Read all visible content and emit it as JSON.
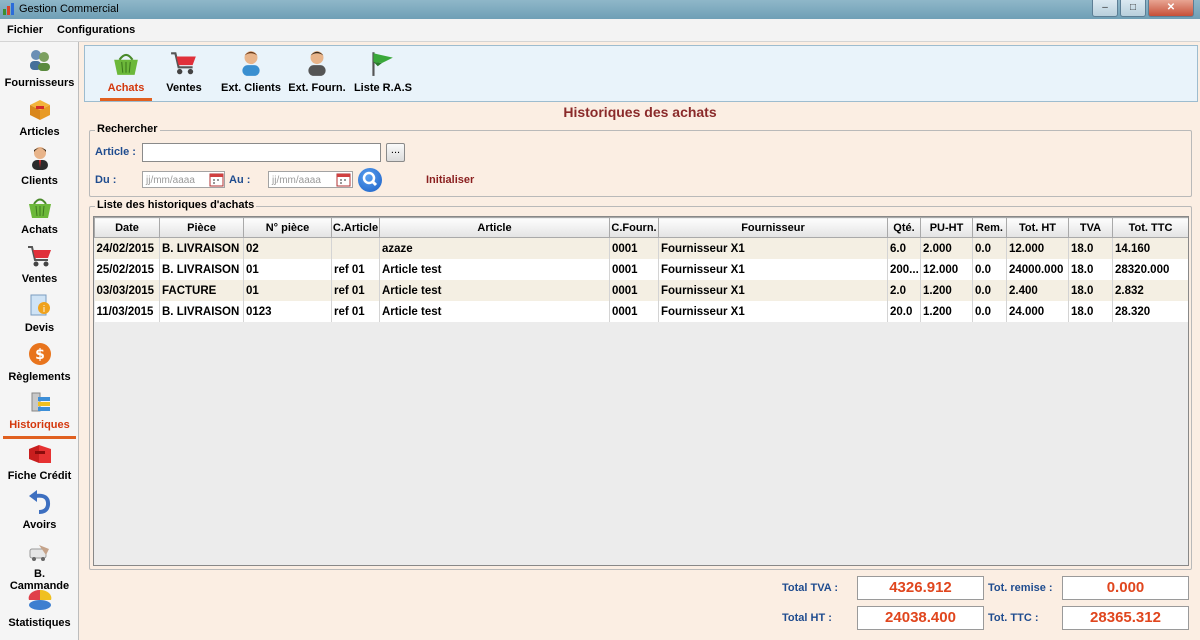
{
  "window": {
    "title": "Gestion Commercial",
    "minimize": "–",
    "maximize": "□",
    "close": "✕"
  },
  "menu": [
    "Fichier",
    "Configurations"
  ],
  "sidebar": [
    {
      "label": "Fournisseurs",
      "icon": "suppliers-icon"
    },
    {
      "label": "Articles",
      "icon": "box-icon"
    },
    {
      "label": "Clients",
      "icon": "client-icon"
    },
    {
      "label": "Achats",
      "icon": "basket-icon"
    },
    {
      "label": "Ventes",
      "icon": "cart-icon"
    },
    {
      "label": "Devis",
      "icon": "quote-icon"
    },
    {
      "label": "Règlements",
      "icon": "dollar-icon"
    },
    {
      "label": "Historiques",
      "icon": "history-icon",
      "active": true
    },
    {
      "label": "Fiche Crédit",
      "icon": "credit-icon"
    },
    {
      "label": "Avoirs",
      "icon": "undo-icon"
    },
    {
      "label": "B. Cammande",
      "icon": "order-icon"
    },
    {
      "label": "Statistiques",
      "icon": "stats-icon"
    }
  ],
  "toolbar": [
    {
      "label": "Achats",
      "icon": "basket-icon",
      "active": true
    },
    {
      "label": "Ventes",
      "icon": "cart-icon"
    },
    {
      "label": "Ext. Clients",
      "icon": "client-icon"
    },
    {
      "label": "Ext. Fourn.",
      "icon": "supplier-icon"
    },
    {
      "label": "Liste R.A.S",
      "icon": "flag-icon"
    }
  ],
  "page_title": "Historiques des achats",
  "search": {
    "legend": "Rechercher",
    "article_label": "Article :",
    "article_value": "",
    "browse_label": "...",
    "du_label": "Du :",
    "au_label": "Au :",
    "date_placeholder": "jj/mm/aaaa",
    "reset_label": "Initialiser"
  },
  "list": {
    "legend": "Liste des historiques d'achats",
    "columns": [
      "Date",
      "Pièce",
      "N° pièce",
      "C.Article",
      "Article",
      "C.Fourn.",
      "Fournisseur",
      "Qté.",
      "PU-HT",
      "Rem.",
      "Tot. HT",
      "TVA",
      "Tot. TTC"
    ],
    "rows": [
      [
        "24/02/2015",
        "B. LIVRAISON",
        "02",
        "",
        "azaze",
        "0001",
        "Fournisseur X1",
        "6.0",
        "2.000",
        "0.0",
        "12.000",
        "18.0",
        "14.160"
      ],
      [
        "25/02/2015",
        "B. LIVRAISON",
        "01",
        "ref 01",
        "Article test",
        "0001",
        "Fournisseur X1",
        "200...",
        "12.000",
        "0.0",
        "24000.000",
        "18.0",
        "28320.000"
      ],
      [
        "03/03/2015",
        "FACTURE",
        "01",
        "ref 01",
        "Article test",
        "0001",
        "Fournisseur X1",
        "2.0",
        "1.200",
        "0.0",
        "2.400",
        "18.0",
        "2.832"
      ],
      [
        "11/03/2015",
        "B. LIVRAISON",
        "0123",
        "ref 01",
        "Article test",
        "0001",
        "Fournisseur X1",
        "20.0",
        "1.200",
        "0.0",
        "24.000",
        "18.0",
        "28.320"
      ]
    ]
  },
  "totals": {
    "tva_label": "Total TVA :",
    "tva": "4326.912",
    "remise_label": "Tot. remise :",
    "remise": "0.000",
    "ht_label": "Total HT :",
    "ht": "24038.400",
    "ttc_label": "Tot. TTC :",
    "ttc": "28365.312"
  },
  "colors": {
    "accent": "#e06020",
    "title": "#8a2a2a",
    "label": "#1f4c8f",
    "total": "#e0461e"
  }
}
